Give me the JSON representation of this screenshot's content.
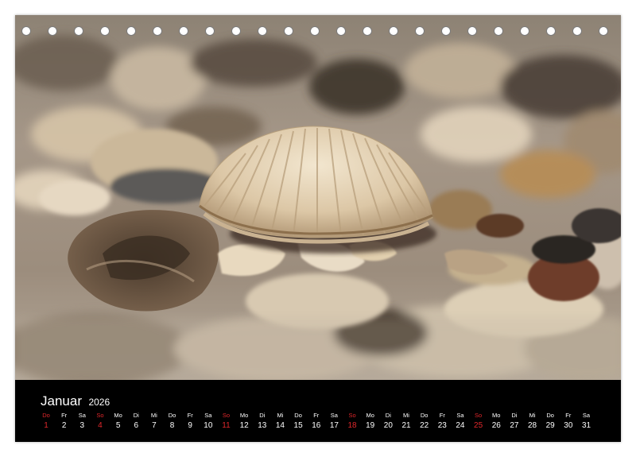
{
  "calendar": {
    "month": "Januar",
    "year": "2026",
    "binding_holes": 23,
    "accent_color": "#e0272b",
    "days": [
      {
        "wd": "Do",
        "num": "1",
        "holiday": true
      },
      {
        "wd": "Fr",
        "num": "2",
        "holiday": false
      },
      {
        "wd": "Sa",
        "num": "3",
        "holiday": false
      },
      {
        "wd": "So",
        "num": "4",
        "holiday": true
      },
      {
        "wd": "Mo",
        "num": "5",
        "holiday": false
      },
      {
        "wd": "Di",
        "num": "6",
        "holiday": false
      },
      {
        "wd": "Mi",
        "num": "7",
        "holiday": false
      },
      {
        "wd": "Do",
        "num": "8",
        "holiday": false
      },
      {
        "wd": "Fr",
        "num": "9",
        "holiday": false
      },
      {
        "wd": "Sa",
        "num": "10",
        "holiday": false
      },
      {
        "wd": "So",
        "num": "11",
        "holiday": true
      },
      {
        "wd": "Mo",
        "num": "12",
        "holiday": false
      },
      {
        "wd": "Di",
        "num": "13",
        "holiday": false
      },
      {
        "wd": "Mi",
        "num": "14",
        "holiday": false
      },
      {
        "wd": "Do",
        "num": "15",
        "holiday": false
      },
      {
        "wd": "Fr",
        "num": "16",
        "holiday": false
      },
      {
        "wd": "Sa",
        "num": "17",
        "holiday": false
      },
      {
        "wd": "So",
        "num": "18",
        "holiday": true
      },
      {
        "wd": "Mo",
        "num": "19",
        "holiday": false
      },
      {
        "wd": "Di",
        "num": "20",
        "holiday": false
      },
      {
        "wd": "Mi",
        "num": "21",
        "holiday": false
      },
      {
        "wd": "Do",
        "num": "22",
        "holiday": false
      },
      {
        "wd": "Fr",
        "num": "23",
        "holiday": false
      },
      {
        "wd": "Sa",
        "num": "24",
        "holiday": false
      },
      {
        "wd": "So",
        "num": "25",
        "holiday": true
      },
      {
        "wd": "Mo",
        "num": "26",
        "holiday": false
      },
      {
        "wd": "Di",
        "num": "27",
        "holiday": false
      },
      {
        "wd": "Mi",
        "num": "28",
        "holiday": false
      },
      {
        "wd": "Do",
        "num": "29",
        "holiday": false
      },
      {
        "wd": "Fr",
        "num": "30",
        "holiday": false
      },
      {
        "wd": "Sa",
        "num": "31",
        "holiday": false
      }
    ]
  },
  "photo": {
    "subject": "shell-on-beach-photo"
  }
}
